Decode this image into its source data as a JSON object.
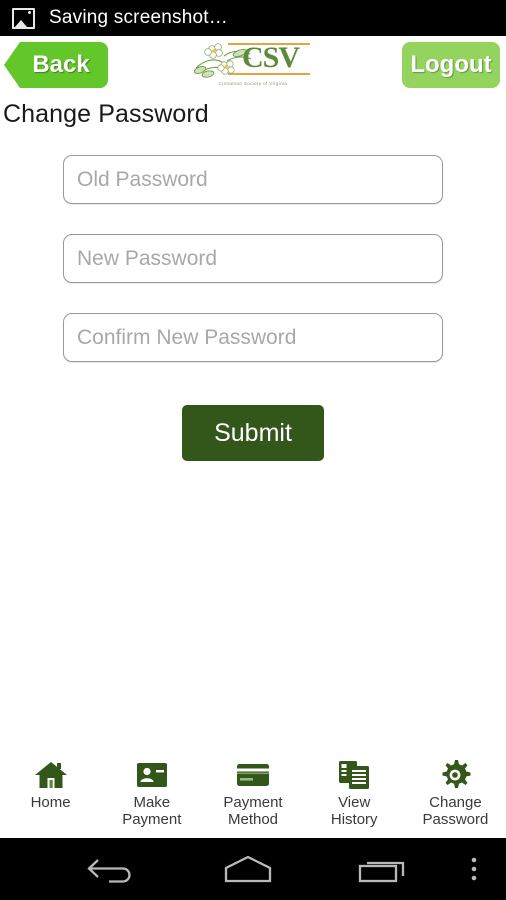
{
  "statusbar": {
    "icon": "image-icon",
    "text": "Saving screenshot…"
  },
  "header": {
    "back_label": "Back",
    "logout_label": "Logout",
    "logo": {
      "wordmark": "CSV",
      "subtitle": "Cinnamon Society of Virginia",
      "flower_icon": "flower-icon"
    }
  },
  "page": {
    "title": "Change Password"
  },
  "form": {
    "fields": [
      {
        "name": "old-password",
        "placeholder": "Old Password",
        "value": ""
      },
      {
        "name": "new-password",
        "placeholder": "New Password",
        "value": ""
      },
      {
        "name": "confirm-new-password",
        "placeholder": "Confirm New Password",
        "value": ""
      }
    ],
    "submit_label": "Submit"
  },
  "bottom_nav": {
    "items": [
      {
        "label": "Home",
        "icon": "home-icon"
      },
      {
        "label": "Make\nPayment",
        "icon": "id-card-icon"
      },
      {
        "label": "Payment\nMethod",
        "icon": "credit-card-icon"
      },
      {
        "label": "View\nHistory",
        "icon": "documents-icon"
      },
      {
        "label": "Change\nPassword",
        "icon": "gear-icon"
      }
    ]
  },
  "system_nav": {
    "back": "back-arrow-icon",
    "home": "home-outline-icon",
    "recents": "recents-icon",
    "menu": "overflow-menu-icon"
  },
  "colors": {
    "back_green": "#63c62a",
    "logout_green": "#94d45e",
    "submit_green": "#33571a",
    "nav_icon_green": "#33571a",
    "logo_green": "#5d8a3a",
    "logo_orange": "#e8a33d",
    "statusbar_bg": "#000000",
    "page_bg": "#ffffff"
  }
}
